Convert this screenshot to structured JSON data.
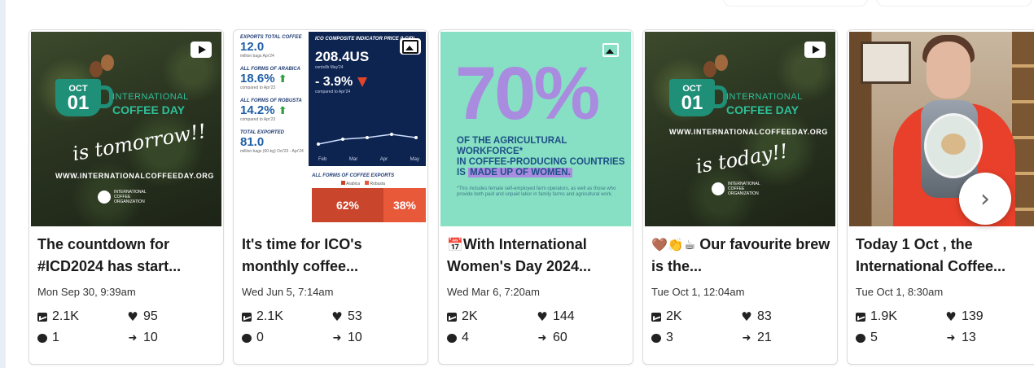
{
  "carousel": {
    "next_icon": "chevron-right-icon",
    "posts": [
      {
        "media_type": "video",
        "thumb": {
          "month": "OCT",
          "day": "01",
          "heading_small": "INTERNATIONAL",
          "heading": "COFFEE DAY",
          "script": "is tomorrow!!",
          "website": "WWW.INTERNATIONALCOFFEEDAY.ORG",
          "org": "INTERNATIONAL COFFEE ORGANIZATION"
        },
        "title": "The countdown for #ICD2024 has start...",
        "date": "Mon Sep 30, 9:39am",
        "impressions": "2.1K",
        "likes": "95",
        "comments": "1",
        "shares": "10"
      },
      {
        "media_type": "image",
        "thumb": {
          "exports_label": "EXPORTS TOTAL COFFEE",
          "exports_value": "12.0",
          "exports_sub": "million bags Apr'24",
          "arabica_label": "ALL FORMS OF ARABICA",
          "arabica_value": "18.6%",
          "arabica_sub": "compared to Apr'23",
          "robusta_label": "ALL FORMS OF ROBUSTA",
          "robusta_value": "14.2%",
          "robusta_sub": "compared to Apr'23",
          "total_label": "TOTAL EXPORTED",
          "total_value": "81.0",
          "total_sub": "million bags (60-kg) Oct'23 - Apr'24",
          "indicator_label": "ICO COMPOSITE INDICATOR PRICE (I-CIP)",
          "indicator_price": "208.4US",
          "indicator_unit": "cents/lb May'24",
          "indicator_change": "- 3.9%",
          "indicator_change_sub": "compared to Apr'24",
          "month_ticks": [
            "Feb",
            "Mar",
            "Apr",
            "May"
          ],
          "split_label": "ALL FORMS OF COFFEE EXPORTS",
          "legend_arabica": "Arabica",
          "legend_robusta": "Robusta",
          "arabica_share": "62%",
          "robusta_share": "38%"
        },
        "title": "It's time for ICO's monthly coffee...",
        "date": "Wed Jun 5, 7:14am",
        "impressions": "2.1K",
        "likes": "53",
        "comments": "0",
        "shares": "10"
      },
      {
        "media_type": "image",
        "thumb": {
          "big_stat": "70%",
          "stat_line1": "OF THE AGRICULTURAL WORKFORCE*",
          "stat_line2": "IN COFFEE-PRODUCING COUNTRIES",
          "stat_line3_pre": "IS ",
          "stat_line3_hl": "MADE UP OF WOMEN.",
          "footnote": "*This includes female self-employed farm operators, as well as those who provide both paid and unpaid labor in family farms and agricultural work."
        },
        "title_emoji": "📅",
        "title": "With International Women's Day 2024...",
        "date": "Wed Mar 6, 7:20am",
        "impressions": "2K",
        "likes": "144",
        "comments": "4",
        "shares": "60"
      },
      {
        "media_type": "video",
        "thumb": {
          "month": "OCT",
          "day": "01",
          "heading_small": "INTERNATIONAL",
          "heading": "COFFEE DAY",
          "website": "WWW.INTERNATIONALCOFFEEDAY.ORG",
          "script": "is today!!",
          "org": "INTERNATIONAL COFFEE ORGANIZATION"
        },
        "title_emoji": "🤎👏☕",
        "title": "Our favourite brew is the...",
        "date": "Tue Oct 1, 12:04am",
        "impressions": "2K",
        "likes": "83",
        "comments": "3",
        "shares": "21"
      },
      {
        "media_type": "video",
        "thumb": {},
        "title": "Today 1 Oct , the International Coffee...",
        "date": "Tue Oct 1, 8:30am",
        "impressions": "1.9K",
        "likes": "139",
        "comments": "5",
        "shares": "13"
      }
    ]
  },
  "colors": {
    "coffee_green": "#1f8f78",
    "mint_bg": "#87e0c3",
    "lavender": "#a98be0",
    "navy": "#0d2450",
    "red": "#e8402a"
  }
}
